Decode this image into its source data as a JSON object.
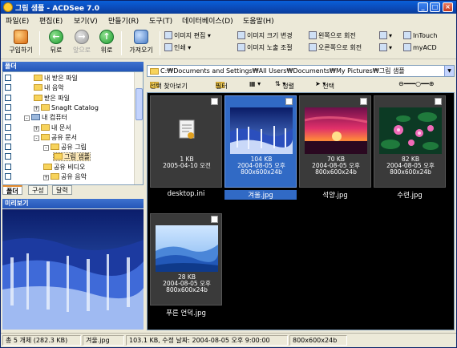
{
  "window": {
    "title": "그림 샘플 - ACDSee 7.0"
  },
  "menu": [
    "파일(E)",
    "편집(E)",
    "보기(V)",
    "만들기(R)",
    "도구(T)",
    "데이터베이스(D)",
    "도움말(H)"
  ],
  "toolbar": {
    "acquire": "구입하기",
    "back": "뒤로",
    "forward": "앞으로",
    "up": "위로",
    "import": "가져오기",
    "edit_image": "이미지 편집",
    "print": "인쇄",
    "resize": "이미지 크기 변경",
    "exposure": "이미지 노출 조절",
    "rotate_left": "왼쪽으로 회전",
    "rotate_right": "오른쪽으로 회전",
    "intouch": "InTouch",
    "myacd": "myACD"
  },
  "folders_panel": {
    "header": "폴더",
    "items": [
      {
        "label": "내 받은 파일",
        "indent": 2,
        "kind": "folder"
      },
      {
        "label": "내 음악",
        "indent": 2,
        "kind": "folder"
      },
      {
        "label": "받은 파일",
        "indent": 2,
        "kind": "folder"
      },
      {
        "label": "SnagIt Catalog",
        "indent": 2,
        "kind": "folder",
        "expand": "+"
      },
      {
        "label": "내 컴퓨터",
        "indent": 1,
        "kind": "pc",
        "expand": "-"
      },
      {
        "label": "내 문서",
        "indent": 2,
        "kind": "folder",
        "expand": "+"
      },
      {
        "label": "공유 문서",
        "indent": 2,
        "kind": "folder",
        "expand": "-"
      },
      {
        "label": "공유 그림",
        "indent": 3,
        "kind": "folder",
        "expand": "-"
      },
      {
        "label": "그림 샘플",
        "indent": 4,
        "kind": "folder",
        "selected": true
      },
      {
        "label": "공유 비디오",
        "indent": 3,
        "kind": "folder"
      },
      {
        "label": "공유 음악",
        "indent": 3,
        "kind": "folder",
        "expand": "+"
      }
    ],
    "tabs": [
      "폴더",
      "구성",
      "달력"
    ]
  },
  "preview_panel": {
    "header": "미리보기"
  },
  "address": {
    "path": "C:₩Documents and Settings₩All Users₩Documents₩My Pictures₩그림 샘플"
  },
  "subtoolbar": {
    "find_image": "선택 찾아보기",
    "filter": "필터",
    "sort": "정렬",
    "select": "선택"
  },
  "files": [
    {
      "name": "desktop.ini",
      "size": "1 KB",
      "date": "2005-04-10 오전",
      "dims": "",
      "selected": false,
      "art": "ini"
    },
    {
      "name": "겨울.jpg",
      "size": "104 KB",
      "date": "2004-08-05 오후",
      "dims": "800x600x24b",
      "selected": true,
      "art": "winter"
    },
    {
      "name": "석양.jpg",
      "size": "70 KB",
      "date": "2004-08-05 오후",
      "dims": "800x600x24b",
      "selected": false,
      "art": "sunset"
    },
    {
      "name": "수련.jpg",
      "size": "82 KB",
      "date": "2004-08-05 오후",
      "dims": "800x600x24b",
      "selected": false,
      "art": "lily"
    },
    {
      "name": "푸른 언덕.jpg",
      "size": "28 KB",
      "date": "2004-08-05 오후",
      "dims": "800x600x24b",
      "selected": false,
      "art": "hills"
    }
  ],
  "status": {
    "total": "총 5 개체 (282.3 KB)",
    "current_file": "겨울.jpg",
    "details": "103.1 KB, 수정 날짜: 2004-08-05 오후 9:00:00",
    "dims": "800x600x24b"
  },
  "colors": {
    "title_bar": "#0b49b6",
    "selection": "#316ac5",
    "panel_header": "#2456b8"
  }
}
